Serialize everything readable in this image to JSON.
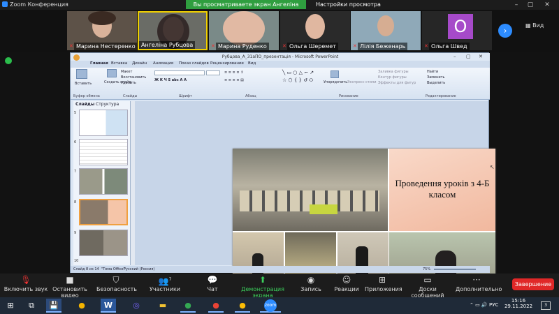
{
  "app": {
    "title": "Zoom Конференция"
  },
  "banner": {
    "text": "Вы просматриваете экран Ангеліна Рубцова",
    "view_settings": "Настройки просмотра ⌄"
  },
  "gallery": {
    "participants": [
      {
        "name": "Марина Нестеренко"
      },
      {
        "name": "Ангеліна Рубцова"
      },
      {
        "name": "Марина Руденко"
      },
      {
        "name": "Ольга Шеремет"
      },
      {
        "name": "Лілія Беженарь"
      },
      {
        "name": "Ольга Швед",
        "initial": "О"
      }
    ],
    "view_label": "Вид"
  },
  "powerpoint": {
    "window_title": "Рубцова_А_31аПО_презентація - Microsoft PowerPoint",
    "tabs": [
      "Главная",
      "Вставка",
      "Дизайн",
      "Анимация",
      "Показ слайдов",
      "Рецензирование",
      "Вид"
    ],
    "ribbon": {
      "paste": "Вставить",
      "layout": "Макет",
      "reset": "Восстановить",
      "create": "Создать слайд",
      "delete": "Удалить",
      "arrange": "Упорядочить",
      "quick_styles": "Экспресс-стили",
      "fill": "Заливка фигуры",
      "outline": "Контур фигуры",
      "effects": "Эффекты для фигур",
      "find": "Найти",
      "replace": "Заменить",
      "select": "Выделить",
      "groups": [
        "Буфер обмена",
        "Слайды",
        "Шрифт",
        "Абзац",
        "Рисование",
        "Редактирование"
      ]
    },
    "pane_tabs": [
      "Слайды",
      "Структура"
    ],
    "thumb_numbers": [
      "5",
      "6",
      "7",
      "8",
      "9",
      "10"
    ],
    "slide_title": "Проведення уроків з 4-Б класом",
    "status": {
      "slide": "Слайд 8 из 14",
      "theme": "\"Тема Office\"",
      "lang": "Русский (Россия)",
      "zoom": "75%"
    }
  },
  "toolbar": {
    "items": [
      {
        "label": "Включить звук"
      },
      {
        "label": "Остановить видео"
      },
      {
        "label": "Безопасность"
      },
      {
        "label": "Участники",
        "count": "7"
      },
      {
        "label": "Чат"
      },
      {
        "label": "Демонстрация экрана"
      },
      {
        "label": "Запись"
      },
      {
        "label": "Реакции"
      },
      {
        "label": "Приложения"
      },
      {
        "label": "Доски сообщений"
      },
      {
        "label": "Дополнительно"
      }
    ],
    "end_label": "Завершение"
  },
  "taskbar": {
    "time": "15:16",
    "date": "29.11.2022",
    "lang": "РУС",
    "badge": "3"
  },
  "colors": {
    "accent": "#2d8cff",
    "share_green": "#2f9e3f",
    "end_red": "#e02828",
    "avatar": "#a64ac9"
  }
}
